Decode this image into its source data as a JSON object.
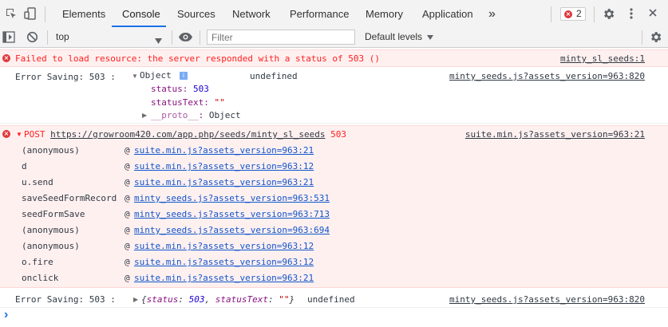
{
  "tabs": [
    {
      "label": "Elements"
    },
    {
      "label": "Console"
    },
    {
      "label": "Sources"
    },
    {
      "label": "Network"
    },
    {
      "label": "Performance"
    },
    {
      "label": "Memory"
    },
    {
      "label": "Application"
    }
  ],
  "more_tabs_glyph": "»",
  "error_count": "2",
  "toolbar": {
    "context": "top",
    "filter_placeholder": "Filter",
    "levels": "Default levels"
  },
  "messages": {
    "m1": {
      "text": "Failed to load resource: the server responded with a status of 503 ()",
      "source": "minty_sl_seeds:1"
    },
    "m2": {
      "prefix": "Error Saving: 503 :",
      "object_label": "Object",
      "undefined": "undefined",
      "source": "minty_seeds.js?assets_version=963:820",
      "props": [
        {
          "key": "status",
          "value": "503"
        },
        {
          "key": "statusText",
          "value": "\"\""
        }
      ],
      "proto_key": "__proto__",
      "proto_value": "Object"
    },
    "m3": {
      "method": "POST",
      "url": "https://growroom420.com/app.php/seeds/minty_sl_seeds",
      "status": "503",
      "source": "suite.min.js?assets_version=963:21",
      "stack": [
        {
          "fn": "(anonymous)",
          "loc": "suite.min.js?assets_version=963:21"
        },
        {
          "fn": "d",
          "loc": "suite.min.js?assets_version=963:12"
        },
        {
          "fn": "u.send",
          "loc": "suite.min.js?assets_version=963:21"
        },
        {
          "fn": "saveSeedFormRecord",
          "loc": "minty_seeds.js?assets_version=963:531"
        },
        {
          "fn": "seedFormSave",
          "loc": "minty_seeds.js?assets_version=963:713"
        },
        {
          "fn": "(anonymous)",
          "loc": "minty_seeds.js?assets_version=963:694"
        },
        {
          "fn": "(anonymous)",
          "loc": "suite.min.js?assets_version=963:12"
        },
        {
          "fn": "o.fire",
          "loc": "suite.min.js?assets_version=963:12"
        },
        {
          "fn": "onclick",
          "loc": "suite.min.js?assets_version=963:21"
        }
      ]
    },
    "m4": {
      "prefix": "Error Saving: 503 :",
      "preview_open": "{",
      "preview_k1": "status",
      "preview_v1": "503",
      "preview_k2": "statusText",
      "preview_v2": "\"\"",
      "preview_close": "}",
      "undefined": "undefined",
      "source": "minty_seeds.js?assets_version=963:820"
    }
  },
  "prompt_glyph": "›"
}
